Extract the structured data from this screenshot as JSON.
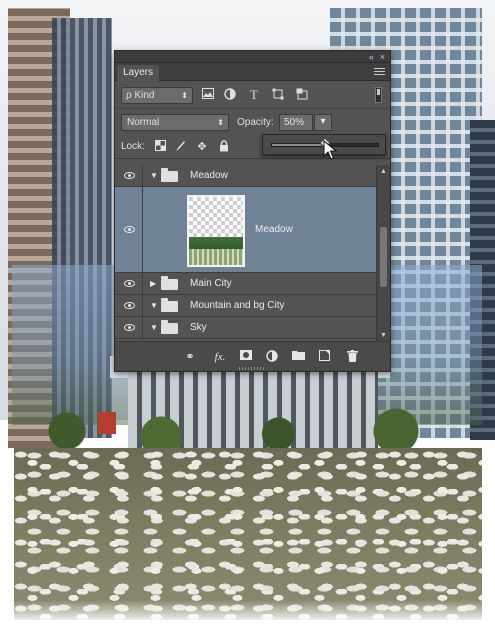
{
  "panel": {
    "collapse_icon": "«",
    "close_icon": "×",
    "tab_label": "Layers",
    "filter_kind_label": "ρ Kind",
    "blend_mode": "Normal",
    "opacity_label": "Opacity:",
    "opacity_value": "50%",
    "opacity_dropdown_arrow": "▾",
    "opacity_slider_value": 0.5,
    "lock_label": "Lock:"
  },
  "layers": [
    {
      "name": "Meadow",
      "type": "group",
      "expanded": true
    },
    {
      "name": "Meadow",
      "type": "pixel-layer",
      "selected": true
    },
    {
      "name": "Main City",
      "type": "group",
      "expanded": false
    },
    {
      "name": "Mountain and bg City",
      "type": "group",
      "expanded": true
    },
    {
      "name": "Sky",
      "type": "group",
      "expanded": true
    }
  ],
  "colors": {
    "panel_bg": "#535353",
    "selected_layer": "#6f8296",
    "panel_dark": "#3c3c3c"
  },
  "icons": {
    "filter": [
      "image-filter-icon",
      "adjustment-filter-icon",
      "type-filter-icon",
      "shape-filter-icon",
      "smart-object-filter-icon"
    ],
    "lock": [
      "lock-transparent-pixels-icon",
      "lock-image-pixels-icon",
      "lock-position-icon",
      "lock-all-icon"
    ],
    "bottom": [
      "link-layers-icon",
      "fx-icon",
      "add-mask-icon",
      "adjustment-layer-icon",
      "new-group-icon",
      "new-layer-icon",
      "delete-icon"
    ]
  }
}
